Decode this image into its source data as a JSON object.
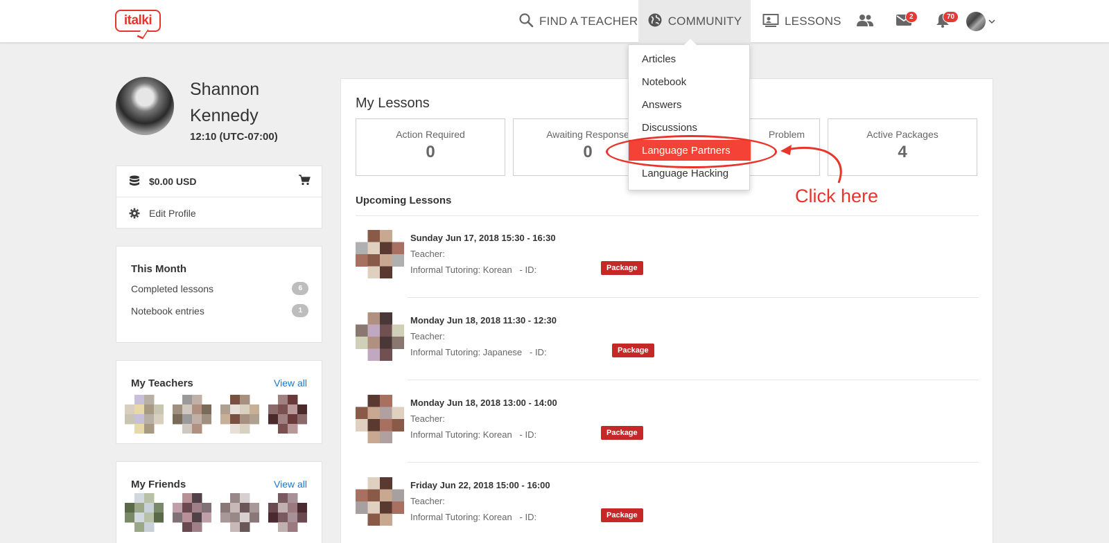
{
  "header": {
    "logo_text": "italki",
    "nav": {
      "find_teacher": "FIND A TEACHER",
      "community": "COMMUNITY",
      "lessons": "LESSONS"
    },
    "messages_badge": "2",
    "notifications_badge": "70"
  },
  "community_menu": {
    "items": [
      {
        "label": "Articles"
      },
      {
        "label": "Notebook"
      },
      {
        "label": "Answers"
      },
      {
        "label": "Discussions"
      },
      {
        "label": "Language Partners",
        "active": true
      },
      {
        "label": "Language Hacking"
      }
    ]
  },
  "annotation": {
    "text": "Click here",
    "color": "#e8352b"
  },
  "profile": {
    "first_name": "Shannon",
    "last_name": "Kennedy",
    "time": "12:10 (UTC-07:00)"
  },
  "wallet": {
    "balance": "$0.00 USD",
    "edit_profile": "Edit Profile"
  },
  "this_month": {
    "title": "This Month",
    "completed_label": "Completed lessons",
    "completed_count": "6",
    "notebook_label": "Notebook entries",
    "notebook_count": "1"
  },
  "my_teachers": {
    "title": "My Teachers",
    "view_all": "View all"
  },
  "my_friends": {
    "title": "My Friends",
    "view_all": "View all"
  },
  "my_lessons": {
    "title": "My Lessons",
    "stats": [
      {
        "label": "Action Required",
        "value": "0"
      },
      {
        "label": "Awaiting Response",
        "value": "0"
      },
      {
        "label": "Problem",
        "value": ""
      },
      {
        "label": "Active Packages",
        "value": "4"
      }
    ],
    "upcoming_title": "Upcoming Lessons",
    "upcoming": [
      {
        "date": "Sunday Jun 17, 2018 15:30 - 16:30",
        "teacher": "Teacher:",
        "type": "Informal Tutoring: Korean",
        "id": "- ID:",
        "badge": "Package"
      },
      {
        "date": "Monday Jun 18, 2018 11:30 - 12:30",
        "teacher": "Teacher:",
        "type": "Informal Tutoring: Japanese",
        "id": "- ID:",
        "badge": "Package"
      },
      {
        "date": "Monday Jun 18, 2018 13:00 - 14:00",
        "teacher": "Teacher:",
        "type": "Informal Tutoring: Korean",
        "id": "- ID:",
        "badge": "Package"
      },
      {
        "date": "Friday Jun 22, 2018 15:00 - 16:00",
        "teacher": "Teacher:",
        "type": "Informal Tutoring: Korean",
        "id": "- ID:",
        "badge": "Package"
      }
    ]
  },
  "colors": {
    "brand_red": "#e8352b",
    "menu_active": "#f44336",
    "package_badge": "#c62828",
    "link_blue": "#1976d2"
  }
}
